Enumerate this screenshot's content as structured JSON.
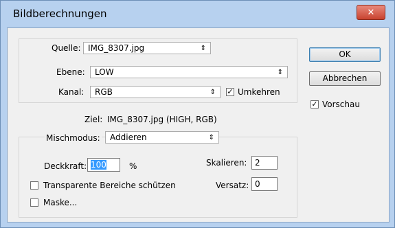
{
  "window": {
    "title": "Bildberechnungen",
    "close_glyph": "✕"
  },
  "source": {
    "label": "Quelle:",
    "value": "IMG_8307.jpg",
    "layer_label": "Ebene:",
    "layer_value": "LOW",
    "channel_label": "Kanal:",
    "channel_value": "RGB",
    "invert_label": "Umkehren",
    "invert_checked": true
  },
  "target": {
    "label": "Ziel:",
    "value": "IMG_8307.jpg (HIGH, RGB)"
  },
  "blending": {
    "mode_label": "Mischmodus:",
    "mode_value": "Addieren",
    "opacity_label": "Deckkraft:",
    "opacity_value": "100",
    "opacity_unit": "%",
    "scale_label": "Skalieren:",
    "scale_value": "2",
    "offset_label": "Versatz:",
    "offset_value": "0",
    "preserve_label": "Transparente Bereiche schützen",
    "mask_label": "Maske..."
  },
  "buttons": {
    "ok": "OK",
    "cancel": "Abbrechen"
  },
  "preview": {
    "label": "Vorschau",
    "checked": true
  },
  "icons": {
    "dropdown_arrow": "⇕",
    "check": "✓"
  }
}
